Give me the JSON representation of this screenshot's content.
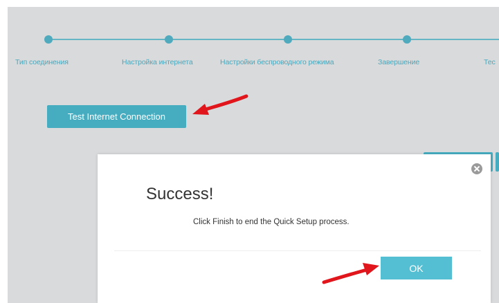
{
  "wizard": {
    "steps": [
      {
        "label": "Тип соединения"
      },
      {
        "label": "Настройка интернета"
      },
      {
        "label": "Настройки беспроводного режима"
      },
      {
        "label": "Завершение"
      },
      {
        "label": "Тес"
      }
    ],
    "test_button_label": "Test Internet Connection"
  },
  "dialog": {
    "title": "Success!",
    "message": "Click Finish to end the Quick Setup process.",
    "ok_label": "OK"
  },
  "colors": {
    "accent": "#46adc1",
    "ok_button": "#54bfd3",
    "background": "#d8dadb",
    "annotation_arrow": "#e0161c"
  },
  "icons": {
    "close": "close-icon",
    "annotation_arrow": "arrow-annotation-icon"
  }
}
